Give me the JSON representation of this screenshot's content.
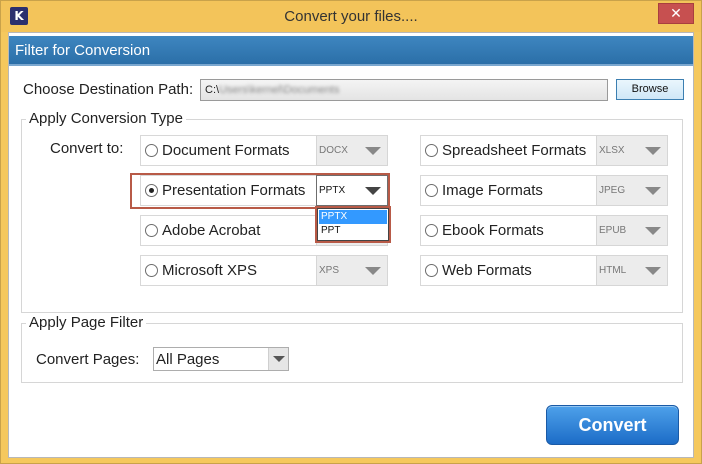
{
  "window": {
    "title": "Convert your files....",
    "logo_letter": "K",
    "close_glyph": "✕"
  },
  "header": {
    "title": "Filter for Conversion"
  },
  "destination": {
    "label": "Choose Destination Path:",
    "path_prefix": "C:\\",
    "path_rest": "Users\\kernel\\Documents",
    "browse_label": "Browse"
  },
  "conversion_type": {
    "title": "Apply Conversion Type",
    "convert_to_label": "Convert to:",
    "left_options": [
      {
        "label": "Document Formats",
        "format": "DOCX",
        "selected": false
      },
      {
        "label": "Presentation Formats",
        "format": "PPTX",
        "selected": true
      },
      {
        "label": "Adobe Acrobat",
        "format": "",
        "selected": false
      },
      {
        "label": "Microsoft XPS",
        "format": "XPS",
        "selected": false
      }
    ],
    "right_options": [
      {
        "label": "Spreadsheet Formats",
        "format": "XLSX",
        "selected": false
      },
      {
        "label": "Image Formats",
        "format": "JPEG",
        "selected": false
      },
      {
        "label": "Ebook Formats",
        "format": "EPUB",
        "selected": false
      },
      {
        "label": "Web Formats",
        "format": "HTML",
        "selected": false
      }
    ],
    "open_dropdown": {
      "items": [
        "PPTX",
        "PPT"
      ],
      "highlighted": "PPTX"
    }
  },
  "page_filter": {
    "title": "Apply Page Filter",
    "pages_label": "Convert Pages:",
    "pages_value": "All Pages"
  },
  "convert_button": "Convert",
  "colors": {
    "header_blue": "#2b6fa8",
    "title_bar": "#f3c45a",
    "highlight": "#b85a47",
    "selection_blue": "#3399ff"
  },
  "icons": {
    "close": "close-icon",
    "logo": "app-logo-icon",
    "dropdown": "chevron-down-icon"
  }
}
